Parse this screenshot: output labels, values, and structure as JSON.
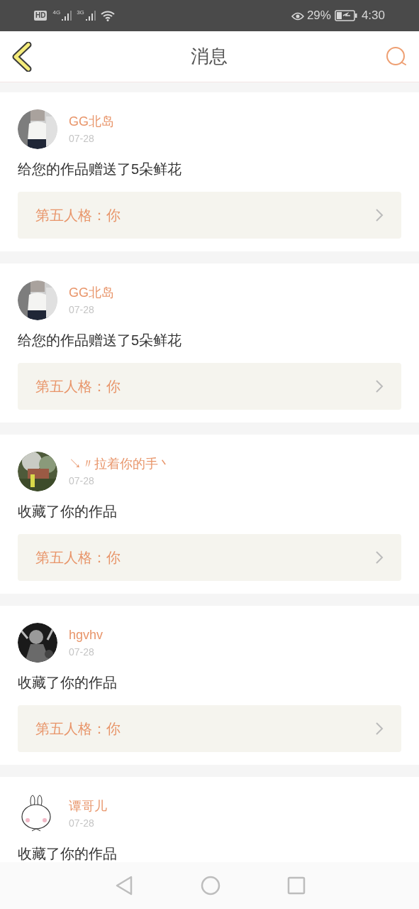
{
  "status_bar": {
    "hd": "HD",
    "networks": [
      "4G",
      "3G"
    ],
    "battery": "29%",
    "time": "4:30"
  },
  "header": {
    "title": "消息"
  },
  "messages": [
    {
      "name": "GG北岛",
      "date": "07-28",
      "action": "给您的作品赠送了5朵鲜花",
      "work": "第五人格：你"
    },
    {
      "name": "GG北岛",
      "date": "07-28",
      "action": "给您的作品赠送了5朵鲜花",
      "work": "第五人格：你"
    },
    {
      "name": "↘〃拉着你的手丶",
      "date": "07-28",
      "action": "收藏了你的作品",
      "work": "第五人格：你"
    },
    {
      "name": "hgvhv",
      "date": "07-28",
      "action": "收藏了你的作品",
      "work": "第五人格：你"
    },
    {
      "name": "谭哥儿",
      "date": "07-28",
      "action": "收藏了你的作品"
    }
  ]
}
